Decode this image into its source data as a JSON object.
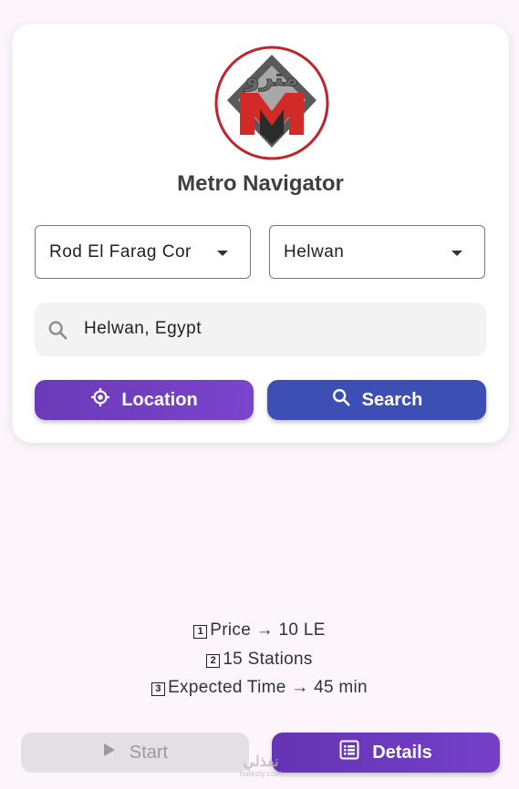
{
  "app": {
    "title": "Metro Navigator",
    "logo_text": "مترو",
    "logo_letter": "M"
  },
  "route": {
    "from_station": "Rod El Farag Cor",
    "to_station": "Helwan"
  },
  "search": {
    "value": "Helwan, Egypt",
    "icon": "search-icon"
  },
  "actions": {
    "location_label": "Location",
    "search_label": "Search"
  },
  "info": {
    "line1_num": "1",
    "line1": "Price → 10 LE",
    "line2_num": "2",
    "line2": "15 Stations",
    "line3_num": "3",
    "line3": "Expected Time → 45 min"
  },
  "bottom": {
    "start_label": "Start",
    "details_label": "Details"
  },
  "watermark": {
    "text": "نفذلي",
    "site": "nafezly.com"
  },
  "colors": {
    "background": "#fcf5fc",
    "location_button": "#6a3ab8",
    "search_button": "#3d4fb5",
    "details_button": "#6434b3",
    "start_button_disabled": "#e3e0e4"
  }
}
